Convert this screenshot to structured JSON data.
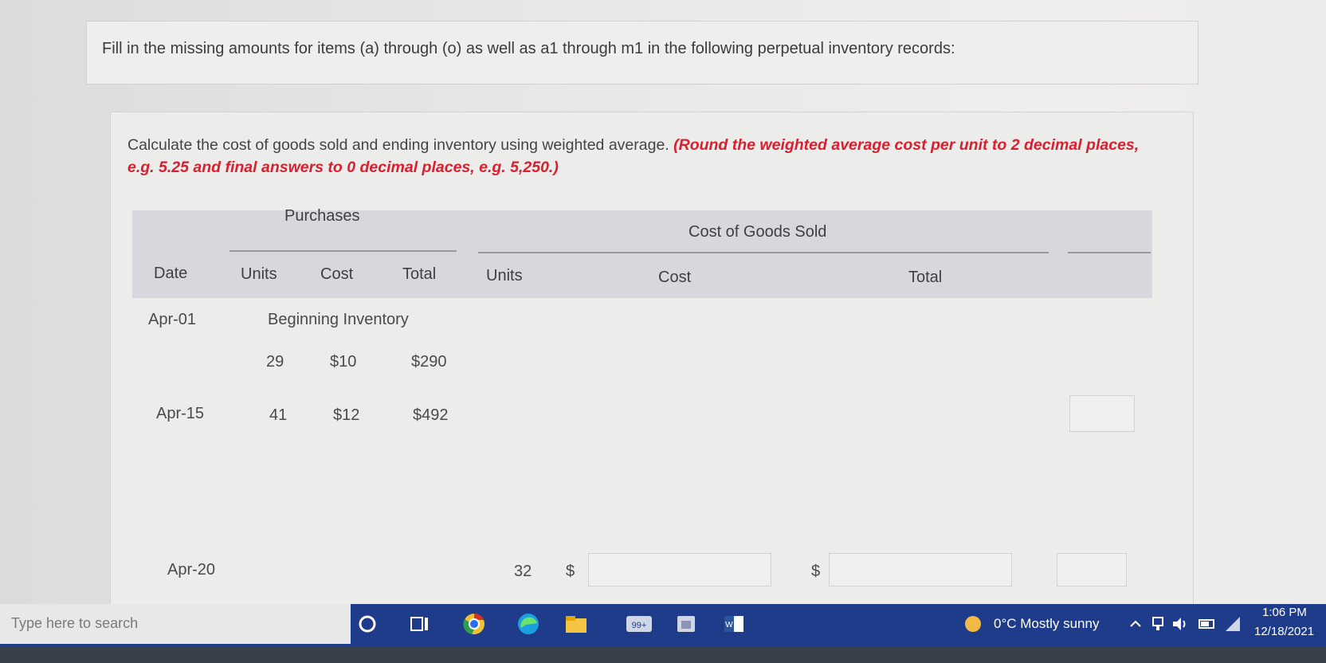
{
  "instruction": "Fill in the missing amounts for items (a) through (o) as well as a1 through m1 in the following perpetual inventory records:",
  "calc_text": "Calculate the cost of goods sold and ending inventory using weighted average.",
  "calc_note": "(Round the weighted average cost per unit to 2 decimal places, e.g. 5.25 and final answers to 0 decimal places, e.g. 5,250.)",
  "table": {
    "group_purchases": "Purchases",
    "group_cogs": "Cost of Goods Sold",
    "col_date": "Date",
    "col_p_units": "Units",
    "col_p_cost": "Cost",
    "col_p_total": "Total",
    "col_c_units": "Units",
    "col_c_cost": "Cost",
    "col_c_total": "Total"
  },
  "rows": {
    "r1_date": "Apr-01",
    "r1_label": "Beginning Inventory",
    "r1_units": "29",
    "r1_cost": "$10",
    "r1_total": "$290",
    "r2_date": "Apr-15",
    "r2_units": "41",
    "r2_cost": "$12",
    "r2_total": "$492",
    "r3_date": "Apr-20",
    "r3_units": "32",
    "r3_dollar1": "$",
    "r3_dollar2": "$"
  },
  "taskbar": {
    "search_placeholder": "Type here to search",
    "badge": "99+",
    "weather": "0°C  Mostly sunny",
    "time": "1:06 PM",
    "date": "12/18/2021"
  },
  "colors": {
    "accent_red": "#d8202f",
    "taskbar_blue": "#1f3c8a",
    "header_bg": "#d7d8de"
  }
}
